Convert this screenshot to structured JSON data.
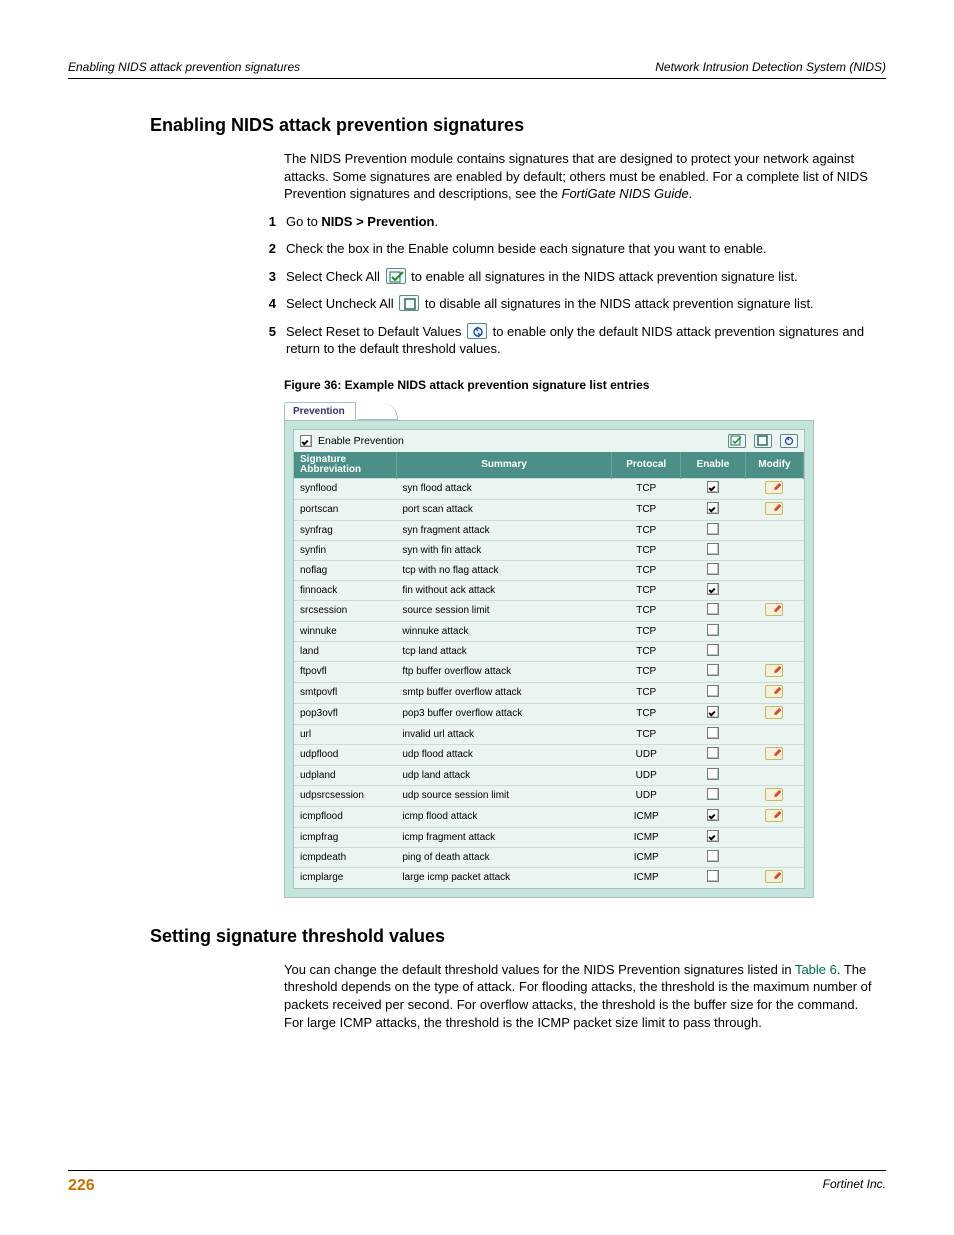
{
  "header": {
    "left": "Enabling NIDS attack prevention signatures",
    "right": "Network Intrusion Detection System (NIDS)"
  },
  "section1": {
    "title": "Enabling NIDS attack prevention signatures",
    "intro_a": "The NIDS Prevention module contains signatures that are designed to protect your network against attacks. Some signatures are enabled by default; others must be enabled. For a complete list of NIDS Prevention signatures and descriptions, see the ",
    "intro_em": "FortiGate NIDS Guide",
    "intro_b": "."
  },
  "steps": {
    "s1_a": "Go to ",
    "s1_b": "NIDS > Prevention",
    "s1_c": ".",
    "s2": "Check the box in the Enable column beside each signature that you want to enable.",
    "s3_a": "Select Check All ",
    "s3_b": " to enable all signatures in the NIDS attack prevention signature list.",
    "s4_a": "Select Uncheck All ",
    "s4_b": " to disable all signatures in the NIDS attack prevention signature list.",
    "s5_a": "Select Reset to Default Values ",
    "s5_b": " to enable only the default NIDS attack prevention signatures and return to the default threshold values."
  },
  "figure": {
    "caption": "Figure 36: Example NIDS attack prevention signature list entries",
    "tab": "Prevention",
    "enable_label": "Enable Prevention",
    "columns": {
      "c1a": "Signature",
      "c1b": "Abbreviation",
      "c2": "Summary",
      "c3": "Protocal",
      "c4": "Enable",
      "c5": "Modify"
    },
    "rows": [
      {
        "abbr": "synflood",
        "summary": "syn flood attack",
        "proto": "TCP",
        "enable": true,
        "modify": true
      },
      {
        "abbr": "portscan",
        "summary": "port scan attack",
        "proto": "TCP",
        "enable": true,
        "modify": true
      },
      {
        "abbr": "synfrag",
        "summary": "syn fragment attack",
        "proto": "TCP",
        "enable": false,
        "modify": false
      },
      {
        "abbr": "synfin",
        "summary": "syn with fin attack",
        "proto": "TCP",
        "enable": false,
        "modify": false
      },
      {
        "abbr": "noflag",
        "summary": "tcp with no flag attack",
        "proto": "TCP",
        "enable": false,
        "modify": false
      },
      {
        "abbr": "finnoack",
        "summary": "fin without ack attack",
        "proto": "TCP",
        "enable": true,
        "modify": false
      },
      {
        "abbr": "srcsession",
        "summary": "source session limit",
        "proto": "TCP",
        "enable": false,
        "modify": true
      },
      {
        "abbr": "winnuke",
        "summary": "winnuke attack",
        "proto": "TCP",
        "enable": false,
        "modify": false
      },
      {
        "abbr": "land",
        "summary": "tcp land attack",
        "proto": "TCP",
        "enable": false,
        "modify": false
      },
      {
        "abbr": "ftpovfl",
        "summary": "ftp buffer overflow attack",
        "proto": "TCP",
        "enable": false,
        "modify": true
      },
      {
        "abbr": "smtpovfl",
        "summary": "smtp buffer overflow attack",
        "proto": "TCP",
        "enable": false,
        "modify": true
      },
      {
        "abbr": "pop3ovfl",
        "summary": "pop3 buffer overflow attack",
        "proto": "TCP",
        "enable": true,
        "modify": true
      },
      {
        "abbr": "url",
        "summary": "invalid url attack",
        "proto": "TCP",
        "enable": false,
        "modify": false
      },
      {
        "abbr": "udpflood",
        "summary": "udp flood attack",
        "proto": "UDP",
        "enable": false,
        "modify": true
      },
      {
        "abbr": "udpland",
        "summary": "udp land attack",
        "proto": "UDP",
        "enable": false,
        "modify": false
      },
      {
        "abbr": "udpsrcsession",
        "summary": "udp source session limit",
        "proto": "UDP",
        "enable": false,
        "modify": true
      },
      {
        "abbr": "icmpflood",
        "summary": "icmp flood attack",
        "proto": "ICMP",
        "enable": true,
        "modify": true
      },
      {
        "abbr": "icmpfrag",
        "summary": "icmp fragment attack",
        "proto": "ICMP",
        "enable": true,
        "modify": false
      },
      {
        "abbr": "icmpdeath",
        "summary": "ping of death attack",
        "proto": "ICMP",
        "enable": false,
        "modify": false
      },
      {
        "abbr": "icmplarge",
        "summary": "large icmp packet attack",
        "proto": "ICMP",
        "enable": false,
        "modify": true
      }
    ]
  },
  "section2": {
    "title": "Setting signature threshold values",
    "para_a": "You can change the default threshold values for the NIDS Prevention signatures listed in ",
    "para_link": "Table 6",
    "para_b": ". The threshold depends on the type of attack. For flooding attacks, the threshold is the maximum number of packets received per second. For overflow attacks, the threshold is the buffer size for the command. For large ICMP attacks, the threshold is the ICMP packet size limit to pass through."
  },
  "footer": {
    "page": "226",
    "publisher": "Fortinet Inc."
  }
}
